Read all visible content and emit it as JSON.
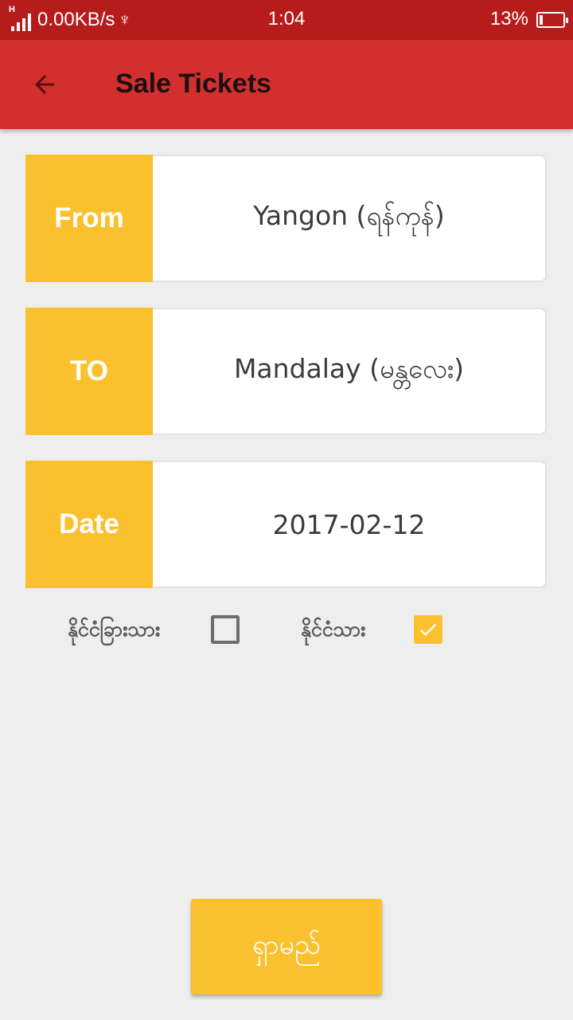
{
  "status_bar": {
    "network_type": "H",
    "speed": "0.00KB/s",
    "usb_icon": "usb-icon",
    "time": "1:04",
    "battery_percent": "13%",
    "battery_level": 0.13
  },
  "app_bar": {
    "back_icon": "arrow-left-icon",
    "title": "Sale Tickets"
  },
  "fields": {
    "from": {
      "label": "From",
      "value": "Yangon (ရန်ကုန်)"
    },
    "to": {
      "label": "TO",
      "value": "Mandalay (မန္တလေး)"
    },
    "date": {
      "label": "Date",
      "value": "2017-02-12"
    }
  },
  "options": {
    "foreigner": {
      "label": "နိုင်ငံခြားသား",
      "checked": false
    },
    "citizen": {
      "label": "နိုင်ငံသား",
      "checked": true
    }
  },
  "search_button": {
    "label": "ရှာမည်"
  },
  "colors": {
    "status_bar": "#b71c1c",
    "app_bar": "#d32f2f",
    "accent": "#fbc02d",
    "background": "#eeeeee"
  }
}
